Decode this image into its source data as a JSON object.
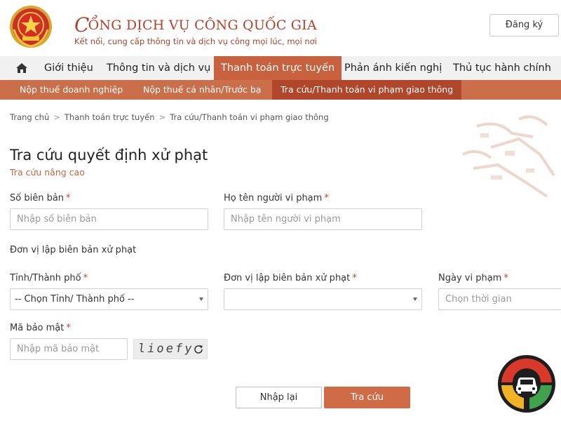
{
  "header": {
    "title_first_letter": "C",
    "title_rest": "ỔNG DỊCH VỤ CÔNG QUỐC GIA",
    "subtitle": "Kết nối, cung cấp thông tin và dịch vụ công mọi lúc, mọi nơi",
    "register_label": "Đăng ký"
  },
  "mainnav": {
    "home_icon": "home-icon",
    "items": [
      "Giới thiệu",
      "Thông tin và dịch vụ",
      "Thanh toán trực tuyến",
      "Phản ánh kiến nghị",
      "Thủ tục hành chính"
    ],
    "active_index": 2
  },
  "subnav": {
    "items": [
      "Nộp thuế doanh nghiệp",
      "Nộp thuế cá nhân/Trước bạ",
      "Tra cứu/Thanh toán vi phạm giao thông"
    ],
    "active_index": 2
  },
  "breadcrumb": [
    "Trang chủ",
    "Thanh toán trực tuyến",
    "Tra cứu/Thanh toán vi phạm giao thông"
  ],
  "page": {
    "title": "Tra cứu quyết định xử phạt",
    "advanced_link": "Tra cứu nâng cao"
  },
  "form": {
    "record_no": {
      "label": "Số biên bản",
      "required": "*",
      "placeholder": "Nhập số biên bản",
      "value": ""
    },
    "violator_name": {
      "label": "Họ tên người vi phạm",
      "required": "*",
      "placeholder": "Nhập tên người vi phạm",
      "value": ""
    },
    "section_unit": "Đơn vị lập biên bản xử phạt",
    "province": {
      "label": "Tỉnh/Thành phố",
      "required": "*",
      "selected": "-- Chọn Tỉnh/ Thành phố --"
    },
    "unit": {
      "label": "Đơn vị lập biên bản xử phạt",
      "required": "*",
      "selected": ""
    },
    "date": {
      "label": "Ngày vi phạm",
      "required": "*",
      "placeholder": "Chọn thời gian",
      "value": ""
    },
    "captcha": {
      "label": "Mã bảo mật",
      "required": "*",
      "placeholder": "Nhập mã bảo mật",
      "code": "lioefy",
      "refresh_icon": "refresh-icon"
    }
  },
  "buttons": {
    "reset": "Nhập lại",
    "search": "Tra cứu"
  },
  "colors": {
    "accent": "#c8613e",
    "subnav": "#cb6e4a",
    "subnav_active": "#b0472b",
    "title_red": "#b3412b"
  }
}
